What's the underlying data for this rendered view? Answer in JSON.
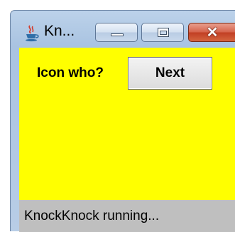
{
  "window": {
    "title": "Kn...",
    "icon": "java-coffee-cup-icon"
  },
  "caption_buttons": {
    "minimize_icon": "minimize-icon",
    "maximize_icon": "maximize-icon",
    "close_glyph": "✕"
  },
  "main": {
    "question_label": "Icon who?",
    "next_button_label": "Next",
    "panel_color": "#ffff00"
  },
  "status_bar": {
    "text": "KnockKnock running..."
  }
}
